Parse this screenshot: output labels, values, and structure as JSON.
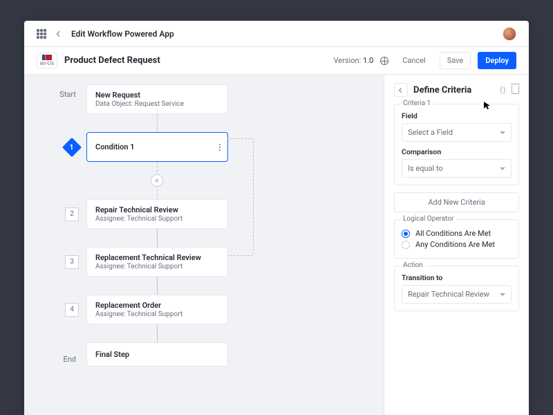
{
  "topbar": {
    "breadcrumb": "Edit Workflow Powered App"
  },
  "subheader": {
    "lang_code": "en-Us",
    "title": "Product Defect Request",
    "version_label": "Version:",
    "version_value": "1.0",
    "cancel": "Cancel",
    "save": "Save",
    "deploy": "Deploy"
  },
  "canvas": {
    "start_label": "Start",
    "end_label": "End",
    "nodes": {
      "start": {
        "title": "New Request",
        "meta_key": "Data Object:",
        "meta_val": "Request Service"
      },
      "cond1": {
        "num": "1",
        "title": "Condition 1"
      },
      "step2": {
        "num": "2",
        "title": "Repair Technical Review",
        "meta_key": "Assignee:",
        "meta_val": "Technical Support"
      },
      "step3": {
        "num": "3",
        "title": "Replacement Technical Review",
        "meta_key": "Assignee:",
        "meta_val": "Technical Support"
      },
      "step4": {
        "num": "4",
        "title": "Replacement Order",
        "meta_key": "Assignee:",
        "meta_val": "Technical Support"
      },
      "final": {
        "title": "Final Step"
      }
    }
  },
  "panel": {
    "title": "Define Criteria",
    "criteria_legend": "Criteria 1",
    "field_label": "Field",
    "field_placeholder": "Select a Field",
    "comp_label": "Comparison",
    "comp_value": "Is equal to",
    "add_criteria": "Add New Criteria",
    "logic_legend": "Logical Operator",
    "logic_all": "All Conditions Are Met",
    "logic_any": "Any Conditions Are Met",
    "action_legend": "Action",
    "transition_label": "Transition to",
    "transition_value": "Repair Technical Review"
  }
}
